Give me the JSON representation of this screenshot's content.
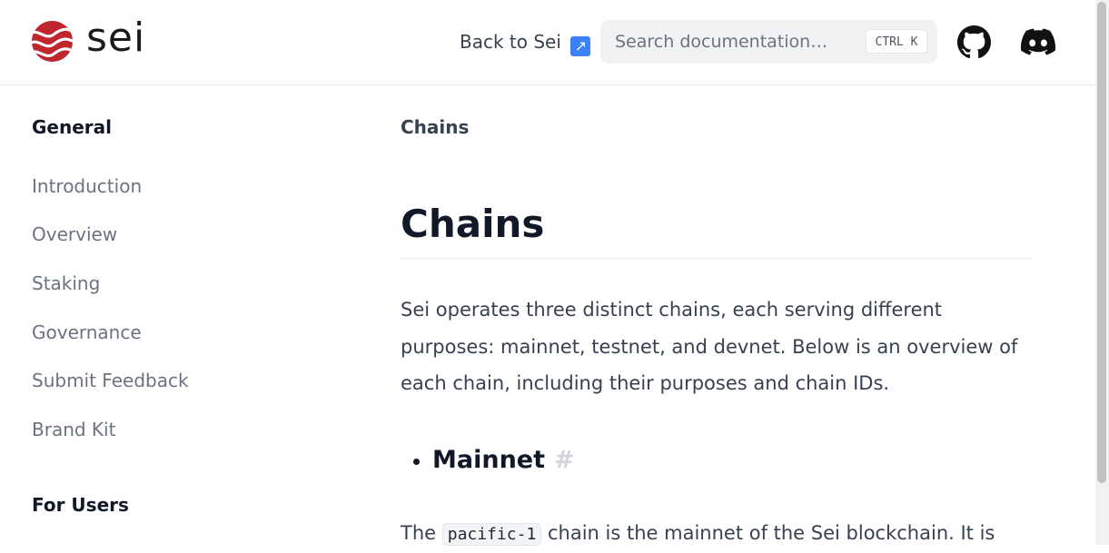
{
  "header": {
    "logo_text": "sei",
    "back_link": "Back to Sei",
    "back_icon": "north-east-arrow-icon",
    "search_placeholder": "Search documentation…",
    "search_shortcut": "CTRL K",
    "accent_color": "#c0262d"
  },
  "sidebar": {
    "sections": [
      {
        "heading": "General",
        "items": [
          "Introduction",
          "Overview",
          "Staking",
          "Governance",
          "Submit Feedback",
          "Brand Kit"
        ]
      },
      {
        "heading": "For Users",
        "items": []
      }
    ]
  },
  "content": {
    "breadcrumb": "Chains",
    "title": "Chains",
    "intro": "Sei operates three distinct chains, each serving different purposes: mainnet, testnet, and devnet. Below is an overview of each chain, including their purposes and chain IDs.",
    "section_heading": "Mainnet",
    "section_anchor": "#",
    "para_prefix": "The",
    "para_code": "pacific-1",
    "para_suffix": "chain is the mainnet of the Sei blockchain. It is"
  }
}
